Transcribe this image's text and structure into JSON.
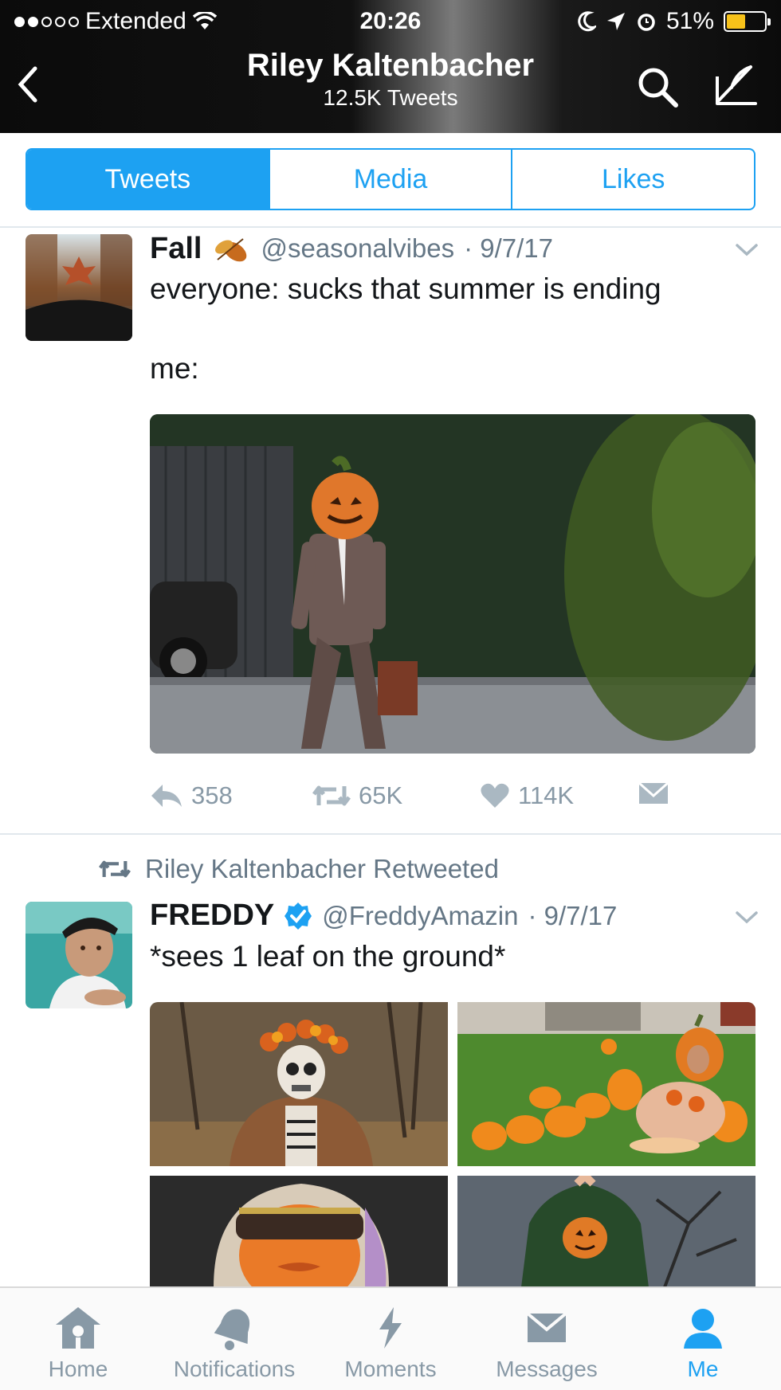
{
  "status_bar": {
    "carrier": "Extended",
    "time": "20:26",
    "battery": "51%",
    "battery_level": 0.51
  },
  "nav": {
    "title": "Riley Kaltenbacher",
    "subtitle": "12.5K Tweets"
  },
  "tabs": [
    {
      "label": "Tweets"
    },
    {
      "label": "Media"
    },
    {
      "label": "Likes"
    }
  ],
  "tweets": [
    {
      "name": "Fall",
      "handle": "@seasonalvibes",
      "date": "· 9/7/17",
      "text_line1": "everyone: sucks that summer is ending",
      "text_line2": "me:",
      "replies": "358",
      "retweets": "65K",
      "likes": "114K"
    },
    {
      "retweeted_by": "Riley Kaltenbacher Retweeted",
      "name": "FREDDY",
      "handle": "@FreddyAmazin",
      "date": "· 9/7/17",
      "text": "*sees 1 leaf on the ground*"
    }
  ],
  "tabbar": [
    {
      "label": "Home",
      "icon": "home-icon"
    },
    {
      "label": "Notifications",
      "icon": "bell-icon"
    },
    {
      "label": "Moments",
      "icon": "lightning-icon"
    },
    {
      "label": "Messages",
      "icon": "envelope-icon"
    },
    {
      "label": "Me",
      "icon": "person-icon"
    }
  ],
  "colors": {
    "accent": "#1da1f2",
    "muted": "#8899a6",
    "battery": "#f7c21a"
  }
}
